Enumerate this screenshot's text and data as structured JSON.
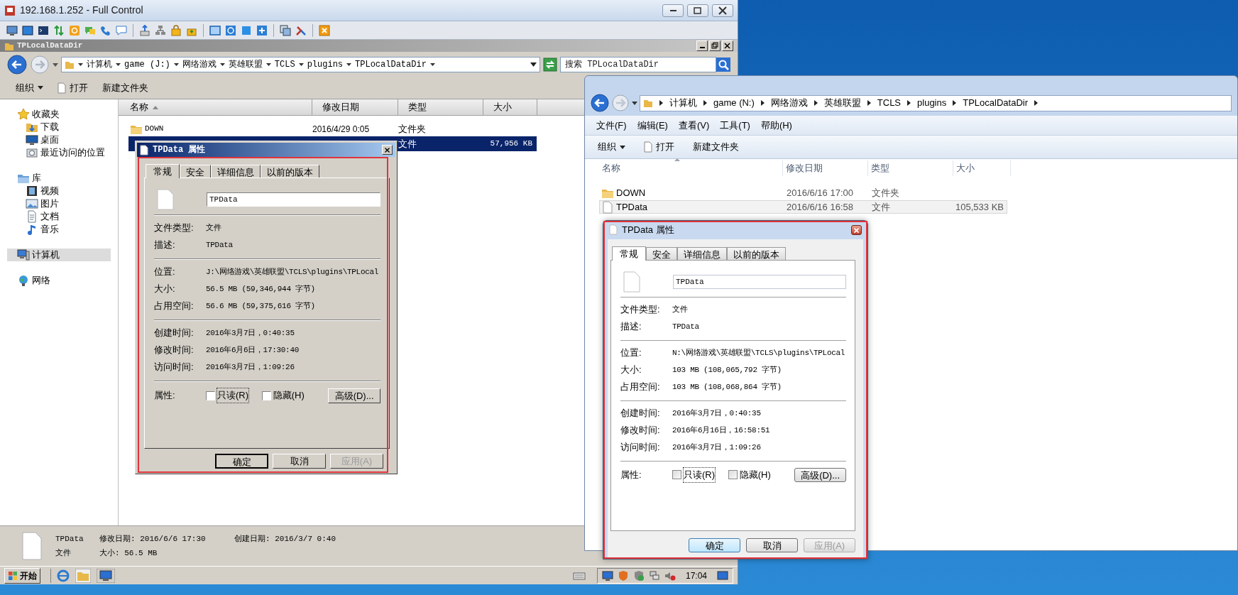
{
  "remote_window": {
    "title": "192.168.1.252 - Full Control"
  },
  "left_explorer": {
    "title": "TPLocalDataDir",
    "breadcrumb": [
      "计算机",
      "game (J:)",
      "网络游戏",
      "英雄联盟",
      "TCLS",
      "plugins",
      "TPLocalDataDir"
    ],
    "search": {
      "placeholder": "搜索 TPLocalDataDir"
    },
    "commands": [
      "组织",
      "打开",
      "新建文件夹"
    ],
    "sidebar": {
      "items": [
        {
          "label": "收藏夹",
          "kind": "star",
          "selected": false,
          "children": [
            {
              "label": "下载",
              "kind": "download",
              "selected": false
            },
            {
              "label": "桌面",
              "kind": "desktop",
              "selected": false
            },
            {
              "label": "最近访问的位置",
              "kind": "recent",
              "selected": false
            }
          ]
        },
        {
          "label": "库",
          "kind": "library",
          "selected": false,
          "children": [
            {
              "label": "视频",
              "kind": "video",
              "selected": false
            },
            {
              "label": "图片",
              "kind": "picture",
              "selected": false
            },
            {
              "label": "文档",
              "kind": "document",
              "selected": false
            },
            {
              "label": "音乐",
              "kind": "music",
              "selected": false
            }
          ]
        },
        {
          "label": "计算机",
          "kind": "computer",
          "selected": true
        },
        {
          "label": "网络",
          "kind": "network",
          "selected": false
        }
      ]
    },
    "columns": [
      "名称",
      "修改日期",
      "类型",
      "大小"
    ],
    "rows": [
      {
        "kind": "folder",
        "name": "DOWN",
        "date": "2016/4/29 0:05",
        "type": "文件夹",
        "selected": false
      },
      {
        "type": "文件",
        "size": "57,956 KB",
        "selected": true
      }
    ],
    "details": {
      "name": "TPData",
      "modified": "修改日期: 2016/6/6 17:30",
      "created": "创建日期: 2016/3/7 0:40",
      "type": "文件",
      "size": "大小: 56.5 MB"
    }
  },
  "left_dialog": {
    "kind": "classic",
    "title": "TPData 属性",
    "tabs": [
      {
        "label": "常规",
        "selected": true
      },
      {
        "label": "安全",
        "selected": false
      },
      {
        "label": "详细信息",
        "selected": false
      },
      {
        "label": "以前的版本",
        "selected": false
      }
    ],
    "file_name": "TPData",
    "sections": [
      [
        {
          "label": "文件类型:",
          "value": "文件"
        },
        {
          "label": "描述:",
          "value": "TPData"
        }
      ],
      [
        {
          "label": "位置:",
          "value": "J:\\网络游戏\\英雄联盟\\TCLS\\plugins\\TPLocal"
        },
        {
          "label": "大小:",
          "value": "56.5 MB (59,346,944 字节)"
        },
        {
          "label": "占用空间:",
          "value": "56.6 MB (59,375,616 字节)"
        }
      ],
      [
        {
          "label": "创建时间:",
          "value": "2016年3月7日，0:40:35"
        },
        {
          "label": "修改时间:",
          "value": "2016年6月6日，17:30:40"
        },
        {
          "label": "访问时间:",
          "value": "2016年3月7日，1:09:26"
        }
      ]
    ],
    "attributes_label": "属性:",
    "attributes": [
      {
        "label": "只读(R)",
        "checked": false
      },
      {
        "label": "隐藏(H)",
        "checked": false
      }
    ],
    "advanced_button": "高级(D)...",
    "buttons": [
      {
        "label": "确定",
        "default": true,
        "disabled": false
      },
      {
        "label": "取消",
        "default": false,
        "disabled": false
      },
      {
        "label": "应用(A)",
        "default": false,
        "disabled": true
      }
    ]
  },
  "taskbar": {
    "start": "开始",
    "clock": "17:04"
  },
  "right_explorer": {
    "breadcrumb": [
      "计算机",
      "game (N:)",
      "网络游戏",
      "英雄联盟",
      "TCLS",
      "plugins",
      "TPLocalDataDir"
    ],
    "menu": [
      "文件(F)",
      "编辑(E)",
      "查看(V)",
      "工具(T)",
      "帮助(H)"
    ],
    "commands": [
      "组织",
      "打开",
      "新建文件夹"
    ],
    "columns": [
      "名称",
      "修改日期",
      "类型",
      "大小"
    ],
    "rows": [
      {
        "kind": "folder",
        "name": "DOWN",
        "date": "2016/6/16 17:00",
        "type": "文件夹",
        "selected": false
      },
      {
        "kind": "file",
        "name": "TPData",
        "date": "2016/6/16 16:58",
        "type": "文件",
        "size": "105,533 KB",
        "selected": true
      }
    ]
  },
  "right_dialog": {
    "kind": "aero",
    "title": "TPData 属性",
    "tabs": [
      {
        "label": "常规",
        "selected": true
      },
      {
        "label": "安全",
        "selected": false
      },
      {
        "label": "详细信息",
        "selected": false
      },
      {
        "label": "以前的版本",
        "selected": false
      }
    ],
    "file_name": "TPData",
    "sections": [
      [
        {
          "label": "文件类型:",
          "value": "文件"
        },
        {
          "label": "描述:",
          "value": "TPData"
        }
      ],
      [
        {
          "label": "位置:",
          "value": "N:\\网络游戏\\英雄联盟\\TCLS\\plugins\\TPLocal"
        },
        {
          "label": "大小:",
          "value": "103 MB (108,065,792 字节)"
        },
        {
          "label": "占用空间:",
          "value": "103 MB (108,068,864 字节)"
        }
      ],
      [
        {
          "label": "创建时间:",
          "value": "2016年3月7日，0:40:35"
        },
        {
          "label": "修改时间:",
          "value": "2016年6月16日，16:58:51"
        },
        {
          "label": "访问时间:",
          "value": "2016年3月7日，1:09:26"
        }
      ]
    ],
    "attributes_label": "属性:",
    "attributes": [
      {
        "label": "只读(R)",
        "checked": false
      },
      {
        "label": "隐藏(H)",
        "checked": false
      }
    ],
    "advanced_button": "高级(D)...",
    "buttons": [
      {
        "label": "确定",
        "default": true,
        "disabled": false
      },
      {
        "label": "取消",
        "default": false,
        "disabled": false
      },
      {
        "label": "应用(A)",
        "default": false,
        "disabled": true
      }
    ]
  }
}
